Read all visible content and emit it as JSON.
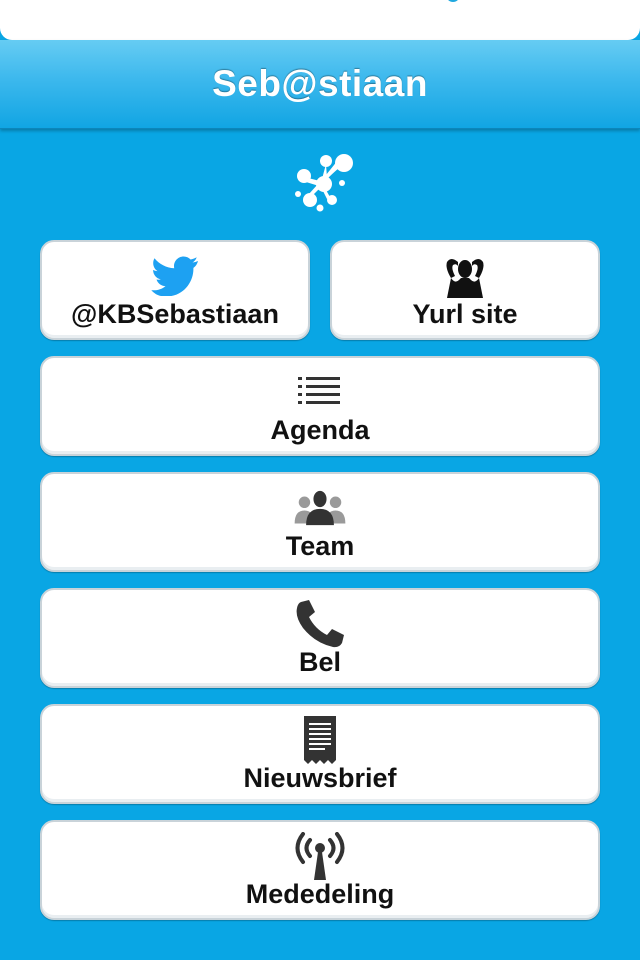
{
  "app": {
    "title": "Seb@stiaan",
    "accent_color": "#09a6e4",
    "logo_icon": "splash-logo-icon"
  },
  "buttons": [
    {
      "label": "@KBSebastiaan",
      "icon": "twitter-bird-icon",
      "icon_color": "#1da1f2"
    },
    {
      "label": "Yurl site",
      "icon": "person-hands-on-head-icon"
    },
    {
      "label": "Agenda",
      "icon": "list-icon"
    },
    {
      "label": "Team",
      "icon": "group-people-icon"
    },
    {
      "label": "Bel",
      "icon": "phone-icon"
    },
    {
      "label": "Nieuwsbrief",
      "icon": "receipt-document-icon"
    },
    {
      "label": "Mededeling",
      "icon": "broadcast-antenna-icon"
    }
  ]
}
